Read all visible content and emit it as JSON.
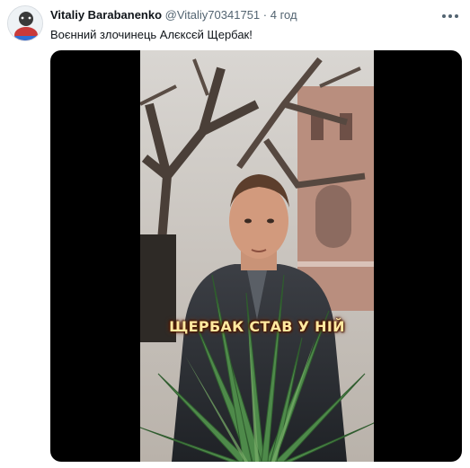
{
  "author": {
    "name": "Vitaliy Barabanenko",
    "handle": "@Vitaliy70341751",
    "separator": "·",
    "time": "4 год"
  },
  "tweet": {
    "text": "Воєнний злочинець Алєксєй Щербак!"
  },
  "media": {
    "caption": "ЩЕРБАК СТАВ У НІЙ"
  },
  "icons": {
    "avatar": "avatar-image",
    "more": "more-options-icon"
  }
}
